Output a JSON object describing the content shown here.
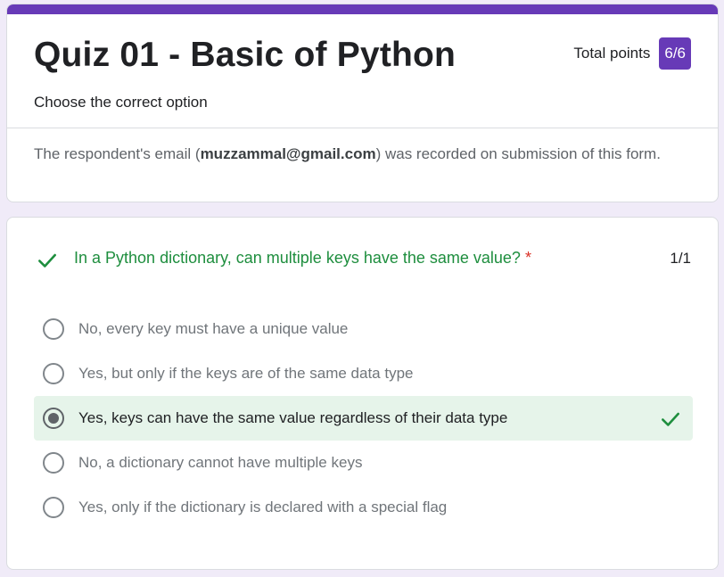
{
  "header": {
    "title": "Quiz 01 - Basic of Python",
    "points_label": "Total points",
    "points_value": "6/6",
    "description": "Choose the correct option",
    "email_prefix": "The respondent's email (",
    "email": "muzzammal@gmail.com",
    "email_suffix": ") was recorded on submission of this form."
  },
  "question": {
    "text": "In a Python dictionary, can multiple keys have the same value?",
    "required_mark": "*",
    "score": "1/1",
    "status_icon": "check-icon",
    "options": [
      {
        "label": "No, every key must have a unique value",
        "selected": false,
        "correct": false
      },
      {
        "label": "Yes, but only if the keys are of the same data type",
        "selected": false,
        "correct": false
      },
      {
        "label": "Yes, keys can have the same value regardless of their data type",
        "selected": true,
        "correct": true
      },
      {
        "label": "No, a dictionary cannot have multiple keys",
        "selected": false,
        "correct": false
      },
      {
        "label": "Yes, only if the dictionary is declared with a special flag",
        "selected": false,
        "correct": false
      }
    ]
  },
  "colors": {
    "accent": "#673ab7",
    "correct_green": "#1e8e3e",
    "correct_bg": "#e6f4ea",
    "required_red": "#d93025",
    "page_bg": "#f0ebf8"
  }
}
